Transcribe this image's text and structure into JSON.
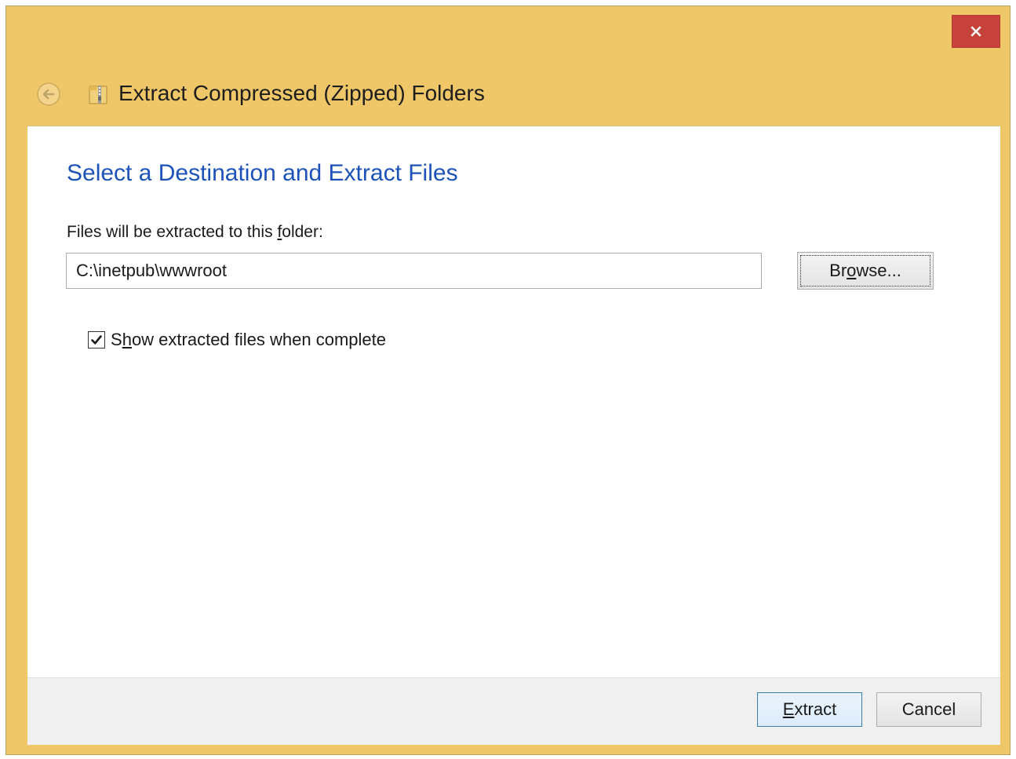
{
  "window": {
    "title": "Extract Compressed (Zipped) Folders",
    "accent_color": "#efc768",
    "close_color": "#c7423a"
  },
  "icons": {
    "close": "close-icon",
    "back": "back-arrow-icon",
    "title": "zipped-folder-icon",
    "check": "checkmark-icon"
  },
  "page": {
    "heading": "Select a Destination and Extract Files",
    "heading_color": "#1d52b8",
    "folder_label_before": "Files will be extracted to this ",
    "folder_label_access_key": "f",
    "folder_label_after": "older:",
    "path_value": "C:\\inetpub\\wwwroot",
    "browse_before": "Br",
    "browse_access_key": "o",
    "browse_after": "wse...",
    "checkbox_checked": true,
    "checkbox_before": "S",
    "checkbox_access_key": "h",
    "checkbox_after": "ow extracted files when complete"
  },
  "footer": {
    "extract_access_key": "E",
    "extract_after": "xtract",
    "cancel_label": "Cancel"
  }
}
